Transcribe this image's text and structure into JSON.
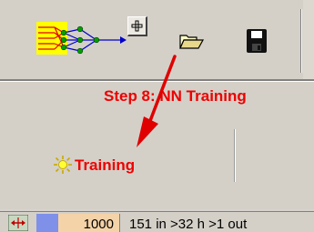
{
  "toolbar": {
    "buttons": [
      {
        "icon": "neural-network-icon"
      },
      {
        "icon": "plus-icon",
        "label": "+"
      },
      {
        "icon": "open-folder-icon"
      },
      {
        "icon": "floppy-disk-icon"
      }
    ]
  },
  "content": {
    "step_caption": "Step 8: NN Training",
    "training_tab": {
      "icon": "sun-icon",
      "label": "Training"
    },
    "arrow_color": "#e00000",
    "accent_color": "#ee0000"
  },
  "status_bar": {
    "icon": "resize-horizontal-icon",
    "count": "1000",
    "topology": "151 in >32 h >1 out"
  }
}
